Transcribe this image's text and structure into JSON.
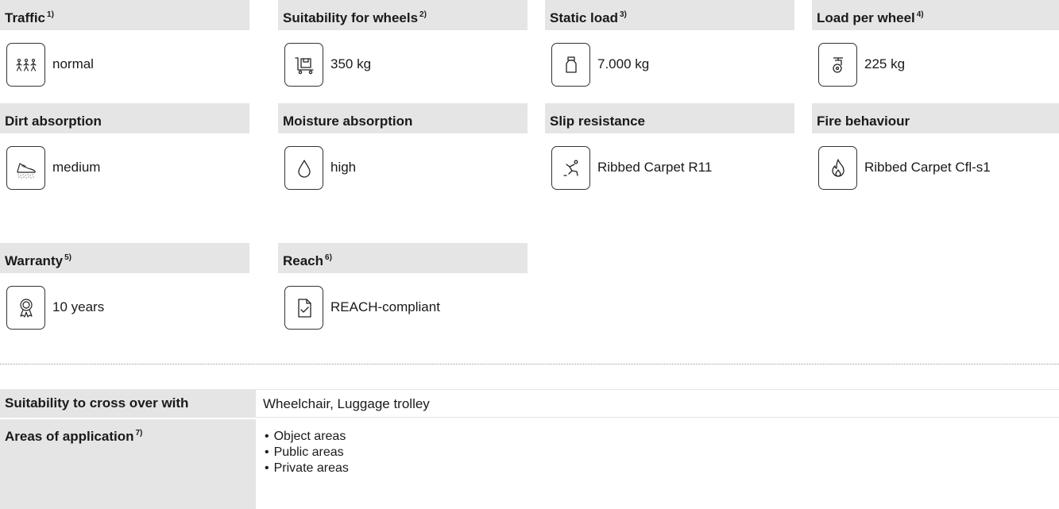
{
  "properties": [
    {
      "title": "Traffic",
      "note": "1)",
      "icon": "pedestrians-icon",
      "value": "normal"
    },
    {
      "title": "Suitability for wheels",
      "note": "2)",
      "icon": "trolley-icon",
      "value": "350 kg"
    },
    {
      "title": "Static load",
      "note": "3)",
      "icon": "weight-icon",
      "value": "7.000 kg"
    },
    {
      "title": "Load per wheel",
      "note": "4)",
      "icon": "caster-wheel-icon",
      "value": "225 kg"
    },
    {
      "title": "Dirt absorption",
      "note": "",
      "icon": "shoe-dirt-icon",
      "value": "medium"
    },
    {
      "title": "Moisture absorption",
      "note": "",
      "icon": "water-drop-icon",
      "value": "high"
    },
    {
      "title": "Slip resistance",
      "note": "",
      "icon": "slipping-person-icon",
      "value": "Ribbed Carpet R11"
    },
    {
      "title": "Fire behaviour",
      "note": "",
      "icon": "flame-icon",
      "value": "Ribbed Carpet Cfl-s1"
    },
    {
      "title": "Warranty",
      "note": "5)",
      "icon": "award-rosette-icon",
      "value": "10 years"
    },
    {
      "title": "Reach",
      "note": "6)",
      "icon": "document-check-icon",
      "value": "REACH-compliant"
    }
  ],
  "details": {
    "crossover_label": "Suitability to cross over with",
    "crossover_value": "Wheelchair, Luggage trolley",
    "areas_label": "Areas of application",
    "areas_note": "7)",
    "areas": [
      "Object areas",
      "Public areas",
      "Private areas"
    ]
  }
}
